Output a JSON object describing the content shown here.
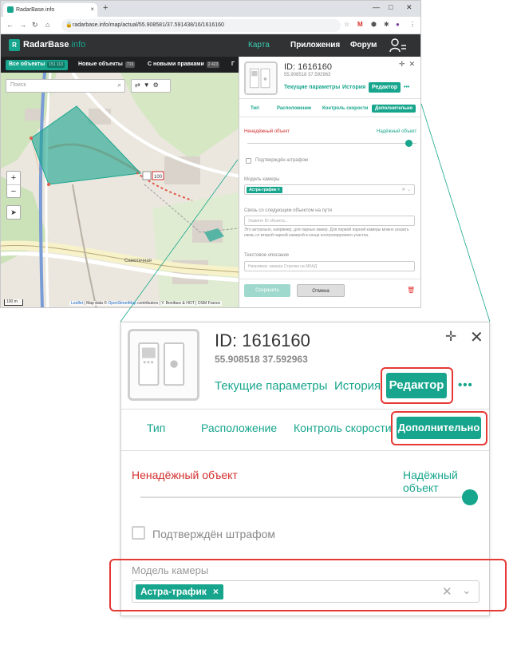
{
  "browser": {
    "tab_title": "RadarBase.info",
    "tab_close": "×",
    "new_tab": "+",
    "win_min": "—",
    "win_max": "□",
    "win_close": "✕",
    "url": "radarbase.info/map/actual/55.908581/37.591438/16/1616160"
  },
  "site": {
    "logo_text": "RadarBase",
    "logo_suffix": ".info",
    "menu": {
      "map": "Карта",
      "apps": "Приложения",
      "forum": "Форум"
    },
    "subnav": [
      {
        "label": "Все объекты",
        "count": "151 113"
      },
      {
        "label": "Новые объекты",
        "count": "719"
      },
      {
        "label": "С новыми правками",
        "count": "2 423"
      }
    ],
    "subnav_partial": "Г",
    "search_placeholder": "Поиск",
    "zoom_in": "+",
    "zoom_out": "−",
    "locate_icon": "➤",
    "scale": "100 m",
    "attribution_leaflet": "Leaflet",
    "attribution_mid": "| Map data ©",
    "attribution_osm": "OpenStreetMap",
    "attribution_tail": "contributors | Y. Boniface & HOT | OSM France",
    "map_label_speed": "100",
    "map_label_street": "Самотечная"
  },
  "camera": {
    "id": "ID: 1616160",
    "coords": "55.908518 37.592963"
  },
  "panel": {
    "tabs": {
      "current_params": "Текущие параметры",
      "history": "История",
      "editor": "Редактор",
      "more": "•••"
    },
    "subtabs": {
      "type": "Тип",
      "location": "Расположение",
      "speed_control": "Контроль скорости",
      "extra": "Дополнительно"
    },
    "reliability": {
      "low": "Ненадёжный объект",
      "high": "Надёжный объект",
      "value_percent": 100
    },
    "confirmed_fine": "Подтверждён штрафом",
    "camera_model_label": "Модель камеры",
    "camera_model_value": "Астра-трафик",
    "chip_remove": "×",
    "select_clear": "✕",
    "select_caret": "⌄",
    "link_label": "Связь со следующим объектом на пути",
    "link_placeholder": "Укажите ID объекта...",
    "link_hint": "Это актуально, например, для парных камер. Для первой парной камеры можно указать связь со второй парной камерой в конце контролируемого участка.",
    "text_desc_label": "Текстовое описание",
    "text_desc_placeholder": "Например: камера Стрелки на МКАД",
    "save": "Сохранить",
    "cancel": "Отмена",
    "delete_icon": "🗑",
    "crosshair_icon": "✛",
    "close_icon": "✕"
  },
  "colors": {
    "accent": "#17a58d",
    "danger": "#d32f2f",
    "header": "#303234",
    "highlight": "#e53935"
  }
}
